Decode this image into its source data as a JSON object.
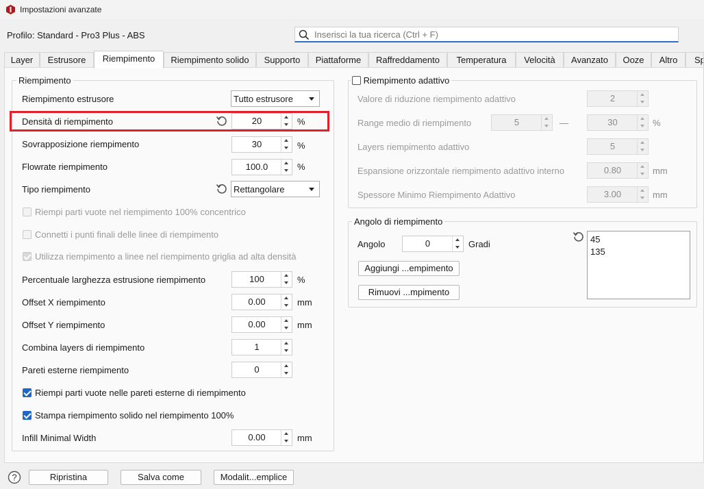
{
  "window": {
    "title": "Impostazioni avanzate"
  },
  "profile": {
    "label": "Profilo: Standard - Pro3 Plus - ABS"
  },
  "search": {
    "placeholder": "Inserisci la tua ricerca (Ctrl + F)"
  },
  "tabs": [
    {
      "label": "Layer"
    },
    {
      "label": "Estrusore"
    },
    {
      "label": "Riempimento"
    },
    {
      "label": "Riempimento solido"
    },
    {
      "label": "Supporto"
    },
    {
      "label": "Piattaforme"
    },
    {
      "label": "Raffreddamento"
    },
    {
      "label": "Temperatura"
    },
    {
      "label": "Velocità"
    },
    {
      "label": "Avanzato"
    },
    {
      "label": "Ooze"
    },
    {
      "label": "Altro"
    },
    {
      "label": "Sp"
    }
  ],
  "active_tab": "Riempimento",
  "infill": {
    "title": "Riempimento",
    "extruder": {
      "label": "Riempimento estrusore",
      "value": "Tutto estrusore"
    },
    "density": {
      "label": "Densità di riempimento",
      "value": "20",
      "unit": "%"
    },
    "overlap": {
      "label": "Sovrapposizione riempimento",
      "value": "30",
      "unit": "%"
    },
    "flowrate": {
      "label": "Flowrate riempimento",
      "value": "100.0",
      "unit": "%"
    },
    "type": {
      "label": "Tipo riempimento",
      "value": "Rettangolare"
    },
    "check_concentric": {
      "label": "Riempi parti vuote nel riempimento 100% concentrico"
    },
    "check_connect": {
      "label": "Connetti i punti finali delle linee di riempimento"
    },
    "check_grid": {
      "label": "Utilizza riempimento a linee nel riempimento griglia ad alta densità"
    },
    "width_pct": {
      "label": "Percentuale larghezza estrusione riempimento",
      "value": "100",
      "unit": "%"
    },
    "offset_x": {
      "label": "Offset X riempimento",
      "value": "0.00",
      "unit": "mm"
    },
    "offset_y": {
      "label": "Offset Y riempimento",
      "value": "0.00",
      "unit": "mm"
    },
    "combine": {
      "label": "Combina layers di riempimento",
      "value": "1"
    },
    "outer_walls": {
      "label": "Pareti esterne riempimento",
      "value": "0"
    },
    "check_fill_walls": {
      "label": "Riempi parti vuote nelle pareti esterne di riempimento"
    },
    "check_solid100": {
      "label": "Stampa riempimento solido nel riempimento 100%"
    },
    "minimal_width": {
      "label": "Infill Minimal Width",
      "value": "0.00",
      "unit": "mm"
    }
  },
  "adaptive": {
    "title": "Riempimento adattivo",
    "reduction": {
      "label": "Valore di riduzione riempimento adattivo",
      "value": "2"
    },
    "range": {
      "label": "Range medio di riempimento",
      "min": "5",
      "dash": "—",
      "max": "30",
      "unit": "%"
    },
    "layers": {
      "label": "Layers riempimento adattivo",
      "value": "5"
    },
    "expansion": {
      "label": "Espansione orizzontale riempimento adattivo interno",
      "value": "0.80",
      "unit": "mm"
    },
    "min_thickness": {
      "label": "Spessore Minimo Riempimento Adattivo",
      "value": "3.00",
      "unit": "mm"
    }
  },
  "angle": {
    "title": "Angolo di riempimento",
    "label": "Angolo",
    "value": "0",
    "unit": "Gradi",
    "add_button": "Aggiungi ...empimento",
    "remove_button": "Rimuovi ...mpimento",
    "list": [
      "45",
      "135"
    ]
  },
  "footer": {
    "reset": "Ripristina",
    "save_as": "Salva come",
    "mode": "Modalit...emplice"
  },
  "colors": {
    "highlight": "#e0202a",
    "accent": "#1f66c5"
  }
}
